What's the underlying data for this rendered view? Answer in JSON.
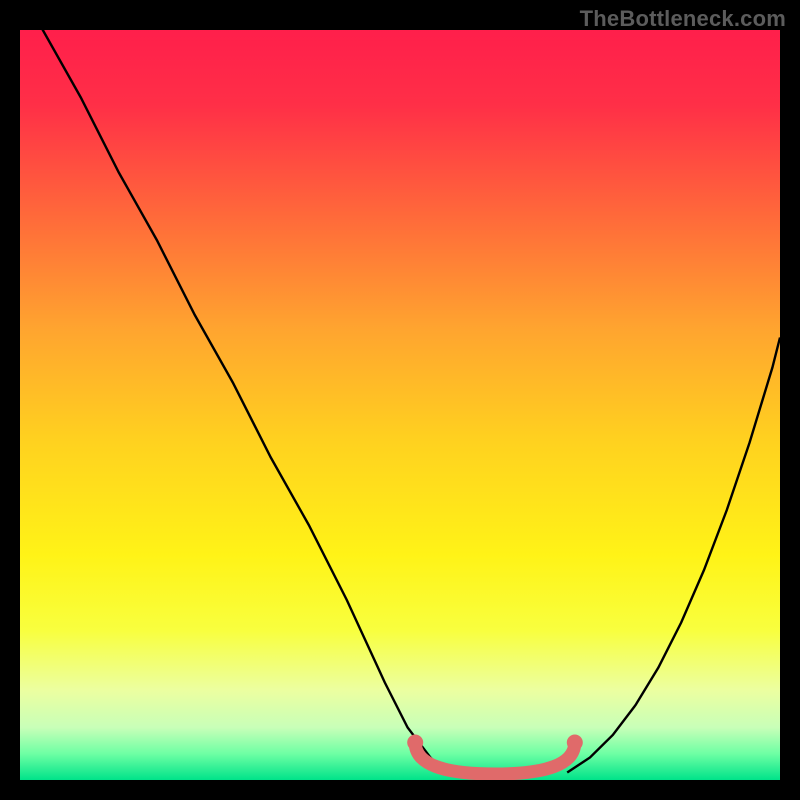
{
  "watermark": "TheBottleneck.com",
  "colors": {
    "background": "#000000",
    "gradient_stops": [
      {
        "offset": 0.0,
        "color": "#ff1f4b"
      },
      {
        "offset": 0.1,
        "color": "#ff2f47"
      },
      {
        "offset": 0.25,
        "color": "#ff6a3a"
      },
      {
        "offset": 0.4,
        "color": "#ffa52f"
      },
      {
        "offset": 0.55,
        "color": "#ffd21f"
      },
      {
        "offset": 0.7,
        "color": "#fff317"
      },
      {
        "offset": 0.8,
        "color": "#f8ff3e"
      },
      {
        "offset": 0.88,
        "color": "#ecffa0"
      },
      {
        "offset": 0.93,
        "color": "#c8ffb8"
      },
      {
        "offset": 0.965,
        "color": "#6effa4"
      },
      {
        "offset": 1.0,
        "color": "#00e38a"
      }
    ],
    "curve": "#000000",
    "band": "#e06a6a"
  },
  "chart_data": {
    "type": "line",
    "title": "",
    "xlabel": "",
    "ylabel": "",
    "xlim": [
      0,
      100
    ],
    "ylim": [
      0,
      100
    ],
    "grid": false,
    "series": [
      {
        "name": "left-branch",
        "x": [
          3,
          8,
          13,
          18,
          23,
          28,
          33,
          38,
          43,
          48,
          51,
          54,
          56
        ],
        "y": [
          100,
          91,
          81,
          72,
          62,
          53,
          43,
          34,
          24,
          13,
          7,
          3,
          1
        ]
      },
      {
        "name": "right-branch",
        "x": [
          72,
          75,
          78,
          81,
          84,
          87,
          90,
          93,
          96,
          99,
          100
        ],
        "y": [
          1,
          3,
          6,
          10,
          15,
          21,
          28,
          36,
          45,
          55,
          59
        ]
      }
    ],
    "valley_band": {
      "xmin": 52,
      "xmax": 73,
      "ymax": 5
    }
  }
}
